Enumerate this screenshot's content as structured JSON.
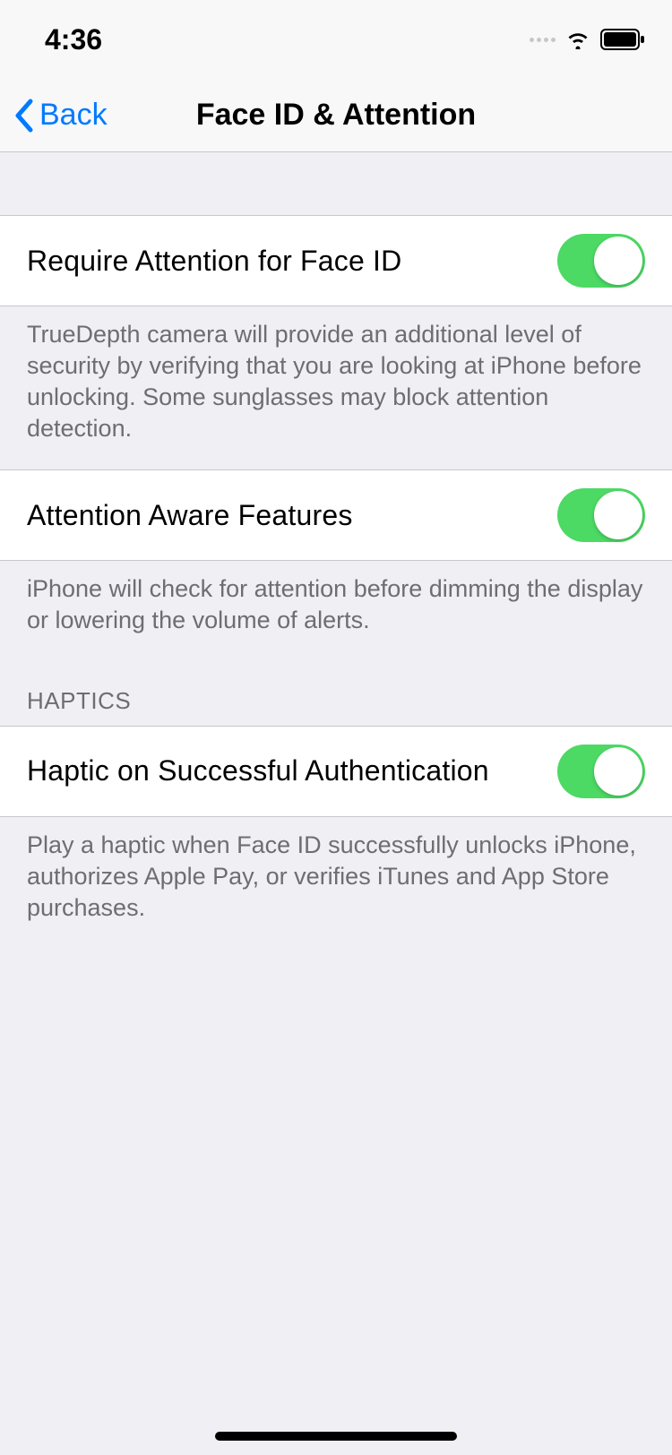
{
  "status": {
    "time": "4:36"
  },
  "nav": {
    "back_label": "Back",
    "title": "Face ID & Attention"
  },
  "sections": {
    "require_attention": {
      "label": "Require Attention for Face ID",
      "footer": "TrueDepth camera will provide an additional level of security by verifying that you are looking at iPhone before unlocking. Some sunglasses may block attention detection.",
      "enabled": true
    },
    "attention_aware": {
      "label": "Attention Aware Features",
      "footer": "iPhone will check for attention before dimming the display or lowering the volume of alerts.",
      "enabled": true
    },
    "haptics_header": "HAPTICS",
    "haptic_auth": {
      "label": "Haptic on Successful Authentication",
      "footer": "Play a haptic when Face ID successfully unlocks iPhone, authorizes Apple Pay, or verifies iTunes and App Store purchases.",
      "enabled": true
    }
  }
}
